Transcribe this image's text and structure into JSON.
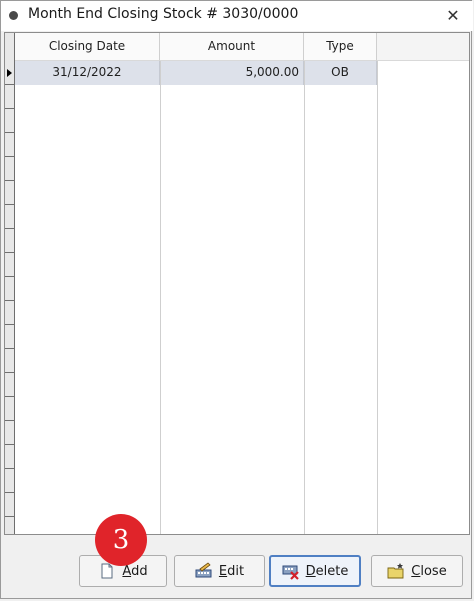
{
  "window": {
    "title": "Month End Closing Stock # 3030/0000",
    "close_glyph": "✕"
  },
  "grid": {
    "columns": [
      "Closing Date",
      "Amount",
      "Type"
    ],
    "rows": [
      {
        "closing_date": "31/12/2022",
        "amount": "5,000.00",
        "type": "OB"
      }
    ]
  },
  "buttons": {
    "add": {
      "label_accel": "A",
      "label_rest": "dd",
      "icon": "new-document-icon"
    },
    "edit": {
      "label_accel": "E",
      "label_rest": "dit",
      "icon": "edit-keyboard-icon"
    },
    "delete": {
      "label_accel": "D",
      "label_rest": "elete",
      "icon": "delete-x-icon"
    },
    "close": {
      "label_accel": "C",
      "label_rest": "lose",
      "icon": "folder-close-icon"
    }
  },
  "callout": {
    "number": "3",
    "color": "#e0242a"
  },
  "colors": {
    "selected_row": "#dde1ea",
    "active_button_border": "#4f7fc3"
  }
}
